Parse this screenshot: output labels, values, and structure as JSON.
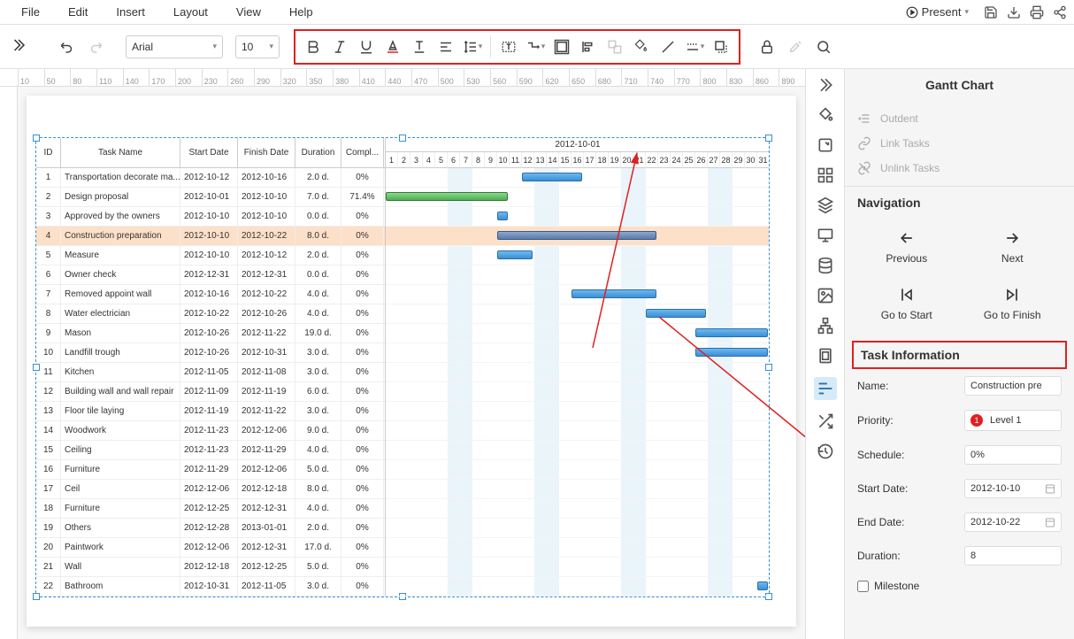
{
  "menu": {
    "items": [
      "File",
      "Edit",
      "Insert",
      "Layout",
      "View",
      "Help"
    ],
    "present": "Present"
  },
  "toolbar": {
    "font": "Arial",
    "size": "10"
  },
  "ruler": [
    10,
    50,
    80,
    110,
    140,
    170,
    200,
    230,
    260,
    290,
    320,
    350,
    380,
    410,
    440,
    470,
    500,
    530,
    560,
    590,
    620,
    650,
    680,
    710,
    740,
    770,
    800,
    830,
    860,
    890
  ],
  "gantt": {
    "monthHeader": "2012-10-01",
    "columns": {
      "id": "ID",
      "name": "Task Name",
      "start": "Start Date",
      "finish": "Finish Date",
      "duration": "Duration",
      "complete": "Compl..."
    },
    "days": [
      1,
      2,
      3,
      4,
      5,
      6,
      7,
      8,
      9,
      10,
      11,
      12,
      13,
      14,
      15,
      16,
      17,
      18,
      19,
      20,
      21,
      22,
      23,
      24,
      25,
      26,
      27,
      28,
      29,
      30,
      31
    ],
    "weekendStarts": [
      6,
      13,
      20,
      27
    ],
    "tasks": [
      {
        "id": 1,
        "name": "Transportation decorate ma...",
        "start": "2012-10-12",
        "finish": "2012-10-16",
        "dur": "2.0 d.",
        "comp": "0%",
        "barStart": 12,
        "barEnd": 16
      },
      {
        "id": 2,
        "name": "Design proposal",
        "start": "2012-10-01",
        "finish": "2012-10-10",
        "dur": "7.0 d.",
        "comp": "71.4%",
        "barStart": 1,
        "barEnd": 10,
        "green": true
      },
      {
        "id": 3,
        "name": "Approved by the owners",
        "start": "2012-10-10",
        "finish": "2012-10-10",
        "dur": "0.0 d.",
        "comp": "0%",
        "barStart": 10,
        "barEnd": 10
      },
      {
        "id": 4,
        "name": "Construction preparation",
        "start": "2012-10-10",
        "finish": "2012-10-22",
        "dur": "8.0 d.",
        "comp": "0%",
        "barStart": 10,
        "barEnd": 22,
        "selected": true
      },
      {
        "id": 5,
        "name": "Measure",
        "start": "2012-10-10",
        "finish": "2012-10-12",
        "dur": "2.0 d.",
        "comp": "0%",
        "barStart": 10,
        "barEnd": 12
      },
      {
        "id": 6,
        "name": "Owner check",
        "start": "2012-12-31",
        "finish": "2012-12-31",
        "dur": "0.0 d.",
        "comp": "0%"
      },
      {
        "id": 7,
        "name": "Removed appoint wall",
        "start": "2012-10-16",
        "finish": "2012-10-22",
        "dur": "4.0 d.",
        "comp": "0%",
        "barStart": 16,
        "barEnd": 22
      },
      {
        "id": 8,
        "name": "Water electrician",
        "start": "2012-10-22",
        "finish": "2012-10-26",
        "dur": "4.0 d.",
        "comp": "0%",
        "barStart": 22,
        "barEnd": 26
      },
      {
        "id": 9,
        "name": "Mason",
        "start": "2012-10-26",
        "finish": "2012-11-22",
        "dur": "19.0 d.",
        "comp": "0%",
        "barStart": 26,
        "barEnd": 31
      },
      {
        "id": 10,
        "name": "Landfill trough",
        "start": "2012-10-26",
        "finish": "2012-10-31",
        "dur": "3.0 d.",
        "comp": "0%",
        "barStart": 26,
        "barEnd": 31
      },
      {
        "id": 11,
        "name": "Kitchen",
        "start": "2012-11-05",
        "finish": "2012-11-08",
        "dur": "3.0 d.",
        "comp": "0%"
      },
      {
        "id": 12,
        "name": "Building wall and wall repair",
        "start": "2012-11-09",
        "finish": "2012-11-19",
        "dur": "6.0 d.",
        "comp": "0%"
      },
      {
        "id": 13,
        "name": "Floor tile laying",
        "start": "2012-11-19",
        "finish": "2012-11-22",
        "dur": "3.0 d.",
        "comp": "0%"
      },
      {
        "id": 14,
        "name": "Woodwork",
        "start": "2012-11-23",
        "finish": "2012-12-06",
        "dur": "9.0 d.",
        "comp": "0%"
      },
      {
        "id": 15,
        "name": "Ceiling",
        "start": "2012-11-23",
        "finish": "2012-11-29",
        "dur": "4.0 d.",
        "comp": "0%"
      },
      {
        "id": 16,
        "name": "Furniture",
        "start": "2012-11-29",
        "finish": "2012-12-06",
        "dur": "5.0 d.",
        "comp": "0%"
      },
      {
        "id": 17,
        "name": "Ceil",
        "start": "2012-12-06",
        "finish": "2012-12-18",
        "dur": "8.0 d.",
        "comp": "0%"
      },
      {
        "id": 18,
        "name": "Furniture",
        "start": "2012-12-25",
        "finish": "2012-12-31",
        "dur": "4.0 d.",
        "comp": "0%"
      },
      {
        "id": 19,
        "name": "Others",
        "start": "2012-12-28",
        "finish": "2013-01-01",
        "dur": "2.0 d.",
        "comp": "0%"
      },
      {
        "id": 20,
        "name": "Paintwork",
        "start": "2012-12-06",
        "finish": "2012-12-31",
        "dur": "17.0 d.",
        "comp": "0%"
      },
      {
        "id": 21,
        "name": "Wall",
        "start": "2012-12-18",
        "finish": "2012-12-25",
        "dur": "5.0 d.",
        "comp": "0%"
      },
      {
        "id": 22,
        "name": "Bathroom",
        "start": "2012-10-31",
        "finish": "2012-11-05",
        "dur": "3.0 d.",
        "comp": "0%",
        "barStart": 31,
        "barEnd": 31
      }
    ]
  },
  "panel": {
    "title": "Gantt Chart",
    "actions": {
      "outdent": "Outdent",
      "link": "Link Tasks",
      "unlink": "Unlink Tasks"
    },
    "navigation": {
      "heading": "Navigation",
      "previous": "Previous",
      "next": "Next",
      "gotoStart": "Go to Start",
      "gotoFinish": "Go to Finish"
    },
    "taskInfo": {
      "heading": "Task Information",
      "nameLabel": "Name:",
      "name": "Construction pre",
      "priorityLabel": "Priority:",
      "priority": "Level 1",
      "priorityNum": "1",
      "scheduleLabel": "Schedule:",
      "schedule": "0%",
      "startLabel": "Start Date:",
      "start": "2012-10-10",
      "endLabel": "End Date:",
      "end": "2012-10-22",
      "durationLabel": "Duration:",
      "duration": "8",
      "milestone": "Milestone"
    }
  }
}
